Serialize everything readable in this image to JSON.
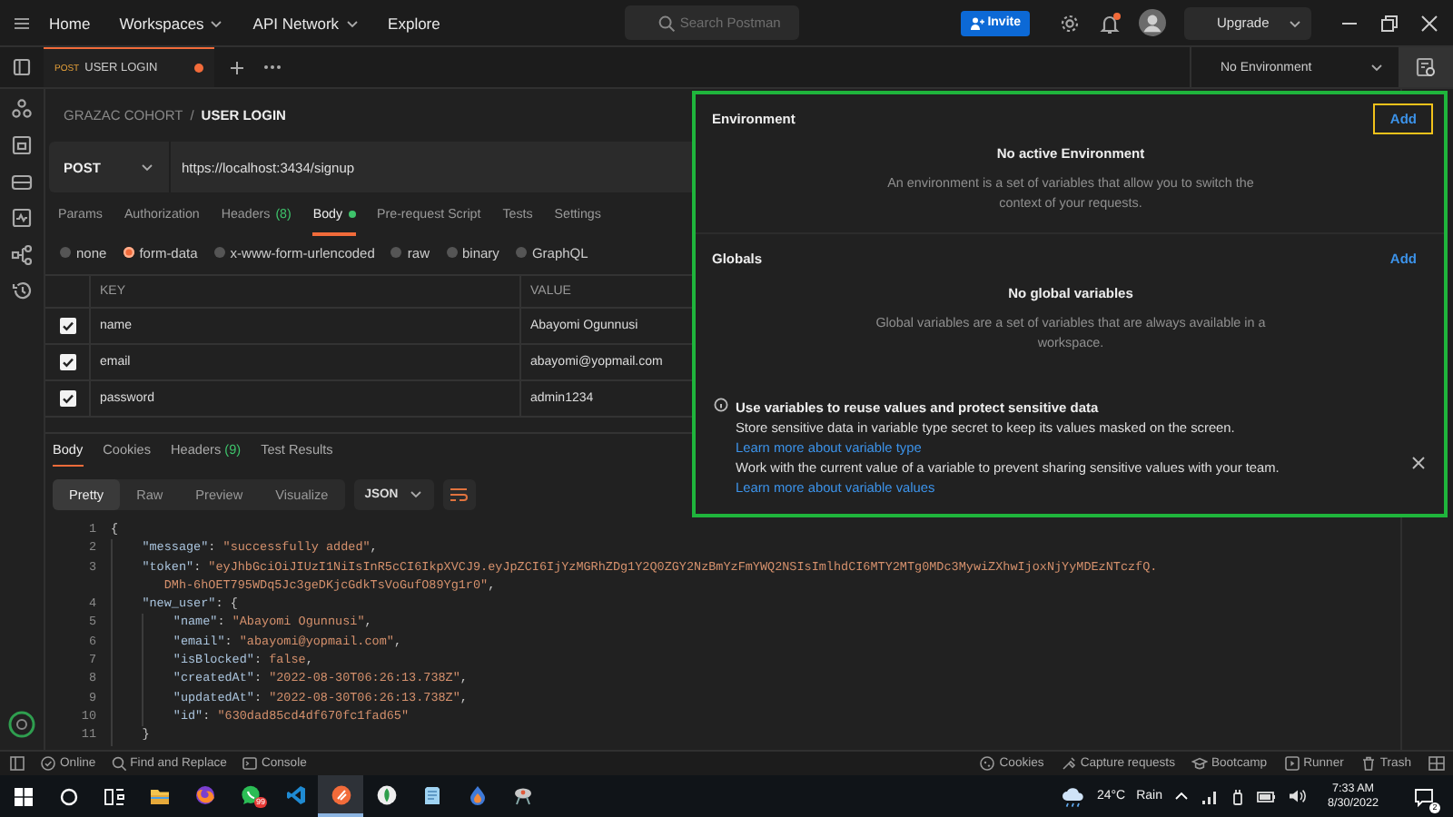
{
  "topbar": {
    "menu": [
      {
        "label": "Home",
        "dropdown": false
      },
      {
        "label": "Workspaces",
        "dropdown": true
      },
      {
        "label": "API Network",
        "dropdown": true
      },
      {
        "label": "Explore",
        "dropdown": false
      }
    ],
    "search": {
      "placeholder": "Search Postman"
    },
    "invite": "Invite",
    "notification_dot": true,
    "upgrade": "Upgrade"
  },
  "tabs": [
    {
      "method": "POST",
      "title": "USER LOGIN",
      "selected": true,
      "unsaved": true
    }
  ],
  "environment_select": "No Environment",
  "breadcrumb": {
    "parent": "GRAZAC COHORT",
    "separator": "/",
    "current": "USER LOGIN"
  },
  "request": {
    "method": "POST",
    "url": "https://localhost:3434/signup"
  },
  "request_tabs": [
    {
      "label": "Params",
      "selected": false
    },
    {
      "label": "Authorization",
      "selected": false
    },
    {
      "label": "Headers",
      "count": "(8)",
      "selected": false
    },
    {
      "label": "Body",
      "selected": true,
      "dot": true
    },
    {
      "label": "Pre-request Script",
      "selected": false
    },
    {
      "label": "Tests",
      "selected": false
    },
    {
      "label": "Settings",
      "selected": false
    }
  ],
  "body_types": [
    {
      "label": "none",
      "selected": false
    },
    {
      "label": "form-data",
      "selected": true
    },
    {
      "label": "x-www-form-urlencoded",
      "selected": false
    },
    {
      "label": "raw",
      "selected": false
    },
    {
      "label": "binary",
      "selected": false
    },
    {
      "label": "GraphQL",
      "selected": false
    }
  ],
  "form_table": {
    "columns": [
      "KEY",
      "VALUE"
    ],
    "rows": [
      {
        "key": "name",
        "value": "Abayomi Ogunnusi",
        "checked": true
      },
      {
        "key": "email",
        "value": "abayomi@yopmail.com",
        "checked": true
      },
      {
        "key": "password",
        "value": "admin1234",
        "checked": true
      }
    ]
  },
  "response_tabs": [
    {
      "label": "Body",
      "selected": true
    },
    {
      "label": "Cookies",
      "selected": false
    },
    {
      "label": "Headers",
      "count": "(9)",
      "selected": false
    },
    {
      "label": "Test Results",
      "selected": false
    }
  ],
  "view_modes": [
    {
      "label": "Pretty",
      "selected": true
    },
    {
      "label": "Raw",
      "selected": false
    },
    {
      "label": "Preview",
      "selected": false
    },
    {
      "label": "Visualize",
      "selected": false
    }
  ],
  "format": "JSON",
  "code_lines": [
    {
      "number": "1",
      "parts": [
        {
          "kind": "punct",
          "text": "{"
        }
      ]
    },
    {
      "number": "2",
      "parts": [
        {
          "kind": "key",
          "text": "    \"message\""
        },
        {
          "kind": "punct",
          "text": ": "
        },
        {
          "kind": "string",
          "text": "\"successfully added\""
        },
        {
          "kind": "punct",
          "text": ","
        }
      ]
    },
    {
      "number": "3",
      "parts": [
        {
          "kind": "key",
          "text": "    \"token\""
        },
        {
          "kind": "punct",
          "text": ": "
        },
        {
          "kind": "string",
          "text": "\"eyJhbGciOiJIUzI1NiIsInR5cCI6IkpXVCJ9.eyJpZCI6IjYzMGRhZDg1Y2Q0ZGY2NzBmYzFmYWQ2NSIsImlhdCI6MTY2MTg0MDc3MywiZXhwIjoxNjYyMDEzNTczfQ."
        }
      ]
    },
    {
      "parts": [
        {
          "kind": "string",
          "text": "       DMh-6hOET795WDq5Jc3geDKjcGdkTsVoGufO89Yg1r0\""
        },
        {
          "kind": "punct",
          "text": ","
        }
      ]
    },
    {
      "number": "4",
      "parts": [
        {
          "kind": "key",
          "text": "    \"new_user\""
        },
        {
          "kind": "punct",
          "text": ": {"
        }
      ]
    },
    {
      "number": "5",
      "parts": [
        {
          "kind": "key",
          "text": "        \"name\""
        },
        {
          "kind": "punct",
          "text": ": "
        },
        {
          "kind": "string",
          "text": "\"Abayomi Ogunnusi\""
        },
        {
          "kind": "punct",
          "text": ","
        }
      ]
    },
    {
      "number": "6",
      "parts": [
        {
          "kind": "key",
          "text": "        \"email\""
        },
        {
          "kind": "punct",
          "text": ": "
        },
        {
          "kind": "string",
          "text": "\"abayomi@yopmail.com\""
        },
        {
          "kind": "punct",
          "text": ","
        }
      ]
    },
    {
      "number": "7",
      "parts": [
        {
          "kind": "key",
          "text": "        \"isBlocked\""
        },
        {
          "kind": "punct",
          "text": ": "
        },
        {
          "kind": "literal",
          "text": "false"
        },
        {
          "kind": "punct",
          "text": ","
        }
      ]
    },
    {
      "number": "8",
      "parts": [
        {
          "kind": "key",
          "text": "        \"createdAt\""
        },
        {
          "kind": "punct",
          "text": ": "
        },
        {
          "kind": "string",
          "text": "\"2022-08-30T06:26:13.738Z\""
        },
        {
          "kind": "punct",
          "text": ","
        }
      ]
    },
    {
      "number": "9",
      "parts": [
        {
          "kind": "key",
          "text": "        \"updatedAt\""
        },
        {
          "kind": "punct",
          "text": ": "
        },
        {
          "kind": "string",
          "text": "\"2022-08-30T06:26:13.738Z\""
        },
        {
          "kind": "punct",
          "text": ","
        }
      ]
    },
    {
      "number": "10",
      "parts": [
        {
          "kind": "key",
          "text": "        \"id\""
        },
        {
          "kind": "punct",
          "text": ": "
        },
        {
          "kind": "string",
          "text": "\"630dad85cd4df670fc1fad65\""
        }
      ]
    },
    {
      "number": "11",
      "parts": [
        {
          "kind": "punct",
          "text": "    }"
        }
      ]
    }
  ],
  "environment_panel": {
    "environment": {
      "title": "Environment",
      "add": "Add",
      "add_focused": true,
      "empty_title": "No active Environment",
      "empty_text": "An environment is a set of variables that allow you to switch the context of your requests."
    },
    "globals": {
      "title": "Globals",
      "add": "Add",
      "add_focused": false,
      "empty_title": "No global variables",
      "empty_text": "Global variables are a set of variables that are always available in a workspace."
    },
    "tip": {
      "title": "Use variables to reuse values and protect sensitive data",
      "lines": [
        {
          "text": "Store sensitive data in variable type secret to keep its values masked on the screen.",
          "link": "Learn more about variable type"
        },
        {
          "text": "Work with the current value of a variable to prevent sharing sensitive values with your team.",
          "link": "Learn more about variable values"
        }
      ]
    }
  },
  "status_bar": {
    "left": [
      {
        "kind": "online",
        "label": "Online"
      },
      {
        "kind": "find",
        "label": "Find and Replace"
      },
      {
        "kind": "console",
        "label": "Console"
      }
    ],
    "right": [
      {
        "kind": "cookies",
        "label": "Cookies"
      },
      {
        "kind": "capture",
        "label": "Capture requests"
      },
      {
        "kind": "bootcamp",
        "label": "Bootcamp"
      },
      {
        "kind": "runner",
        "label": "Runner"
      },
      {
        "kind": "trash",
        "label": "Trash"
      }
    ]
  },
  "taskbar": {
    "apps": [
      {
        "kind": "folder",
        "active": false
      },
      {
        "kind": "firefox",
        "active": false
      },
      {
        "kind": "whatsapp",
        "active": false,
        "badge": "99"
      },
      {
        "kind": "vscode",
        "active": false
      },
      {
        "kind": "postman",
        "active": true
      },
      {
        "kind": "leaf",
        "active": false
      },
      {
        "kind": "notepad",
        "active": false
      },
      {
        "kind": "drop",
        "active": false
      },
      {
        "kind": "tool",
        "active": false
      }
    ],
    "temperature": "24°C",
    "weather": "Rain",
    "time": "7:33 AM",
    "date": "8/30/2022",
    "notifications": "2"
  }
}
